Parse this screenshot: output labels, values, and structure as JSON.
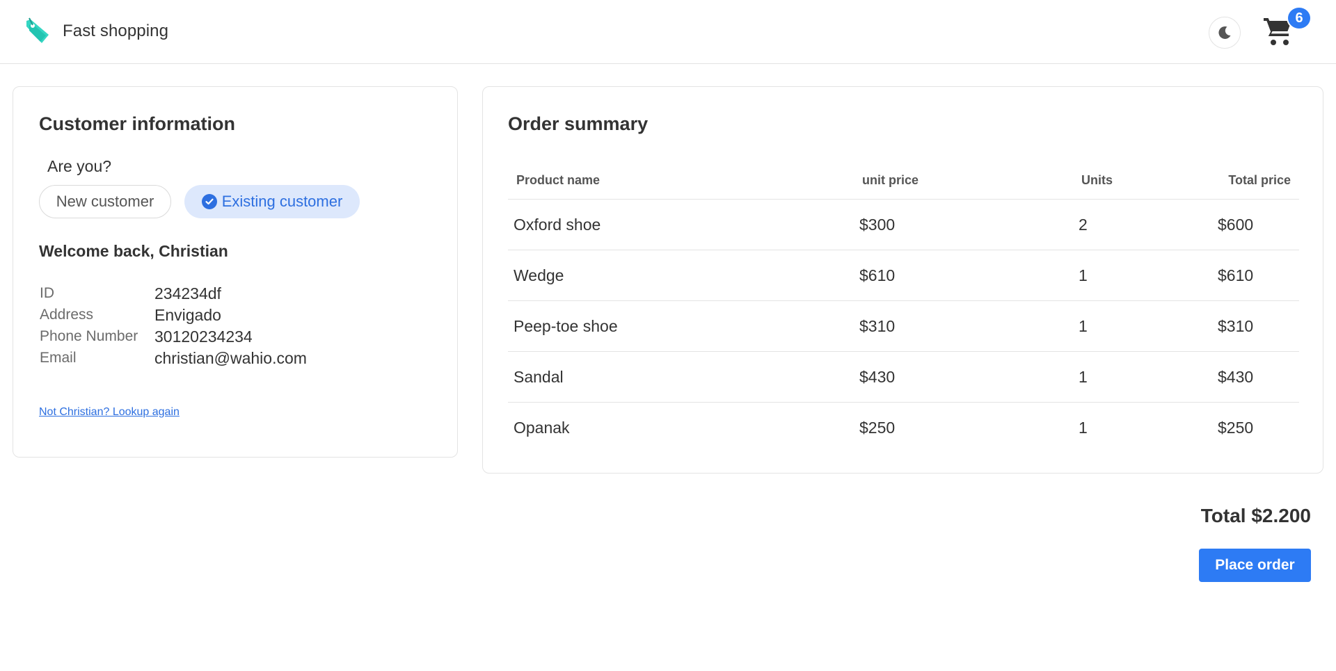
{
  "header": {
    "brand": "Fast shopping",
    "logo_icon": "price-tag-icon",
    "theme_icon": "moon-icon",
    "cart_icon": "shopping-cart-icon",
    "cart_count": "6",
    "accent_color": "#2d7bf4"
  },
  "customer": {
    "title": "Customer information",
    "question": "Are you?",
    "options": {
      "new": "New customer",
      "existing": "Existing customer",
      "selected": "existing"
    },
    "welcome": "Welcome back, Christian",
    "fields": [
      {
        "label": "ID",
        "value": "234234df"
      },
      {
        "label": "Address",
        "value": "Envigado"
      },
      {
        "label": "Phone Number",
        "value": "30120234234"
      },
      {
        "label": "Email",
        "value": "christian@wahio.com"
      }
    ],
    "lookup_link": "Not Christian? Lookup again"
  },
  "order": {
    "title": "Order summary",
    "columns": {
      "name": "Product name",
      "unit_price": "unit price",
      "units": "Units",
      "total": "Total price"
    },
    "rows": [
      {
        "name": "Oxford shoe",
        "unit_price": "$300",
        "units": "2",
        "total": "$600"
      },
      {
        "name": "Wedge",
        "unit_price": "$610",
        "units": "1",
        "total": "$610"
      },
      {
        "name": "Peep-toe shoe",
        "unit_price": "$310",
        "units": "1",
        "total": "$310"
      },
      {
        "name": "Sandal",
        "unit_price": "$430",
        "units": "1",
        "total": "$430"
      },
      {
        "name": "Opanak",
        "unit_price": "$250",
        "units": "1",
        "total": "$250"
      }
    ],
    "total": "Total $2.200",
    "place_order": "Place order"
  }
}
